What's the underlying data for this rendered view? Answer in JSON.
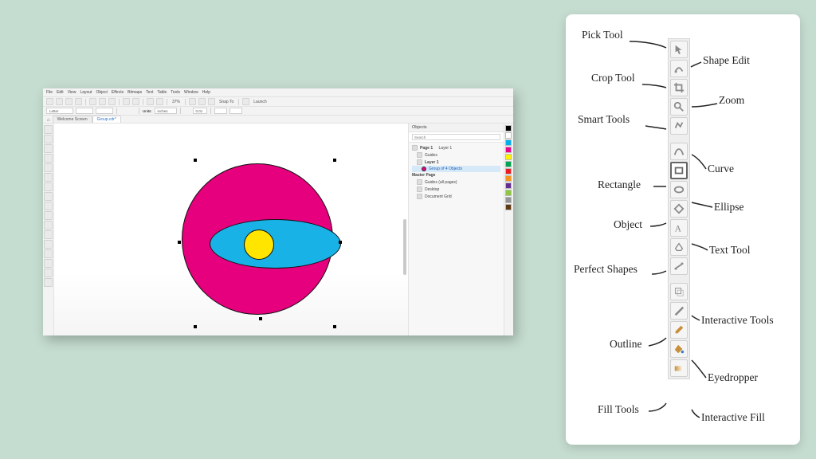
{
  "app": {
    "menu": [
      "File",
      "Edit",
      "View",
      "Layout",
      "Object",
      "Effects",
      "Bitmaps",
      "Text",
      "Table",
      "Tools",
      "Window",
      "Help"
    ],
    "toolbar": {
      "zoom_value": "37%",
      "snap_to": "Snap To",
      "launch": "Launch"
    },
    "propbar": {
      "preset_label": "Letter",
      "units_label": "Units:",
      "units_value": "inches",
      "nudge": "0.01"
    },
    "tabs": [
      {
        "label": "Welcome Screen",
        "active": false
      },
      {
        "label": "Group.cdr*",
        "active": true
      }
    ],
    "objects_panel": {
      "title": "Objects",
      "search_placeholder": "Search",
      "page_label": "Page 1",
      "layer_suffix": "Layer 1",
      "guides": "Guides",
      "layer1": "Layer 1",
      "group_label": "Group of 4 Objects",
      "master_page": "Master Page",
      "guides_all": "Guides (all pages)",
      "desktop": "Desktop",
      "document_grid": "Document Grid"
    },
    "swatch_colors": [
      "#000000",
      "#ffffff",
      "#00aeef",
      "#ec008c",
      "#fff200",
      "#00a651",
      "#ed1c24",
      "#f7941d",
      "#662d91",
      "#8dc63f",
      "#939598",
      "#603913"
    ]
  },
  "diagram": {
    "labels": {
      "pick": "Pick Tool",
      "shape_edit": "Shape Edit",
      "crop": "Crop Tool",
      "zoom": "Zoom",
      "smart": "Smart Tools",
      "curve": "Curve",
      "rectangle": "Rectangle",
      "ellipse": "Ellipse",
      "object": "Object",
      "text": "Text Tool",
      "perfect": "Perfect Shapes",
      "interactive_tools": "Interactive Tools",
      "outline": "Outline",
      "eyedropper": "Eyedropper",
      "fill": "Fill Tools",
      "interactive_fill": "Interactive Fill"
    },
    "tools": [
      "pick",
      "shape-edit",
      "crop",
      "zoom",
      "smart",
      "curve",
      "rectangle",
      "ellipse",
      "object",
      "text",
      "perfect-shapes",
      "dimension",
      "interactive-tools",
      "outline",
      "eyedropper",
      "fill",
      "interactive-fill"
    ]
  }
}
